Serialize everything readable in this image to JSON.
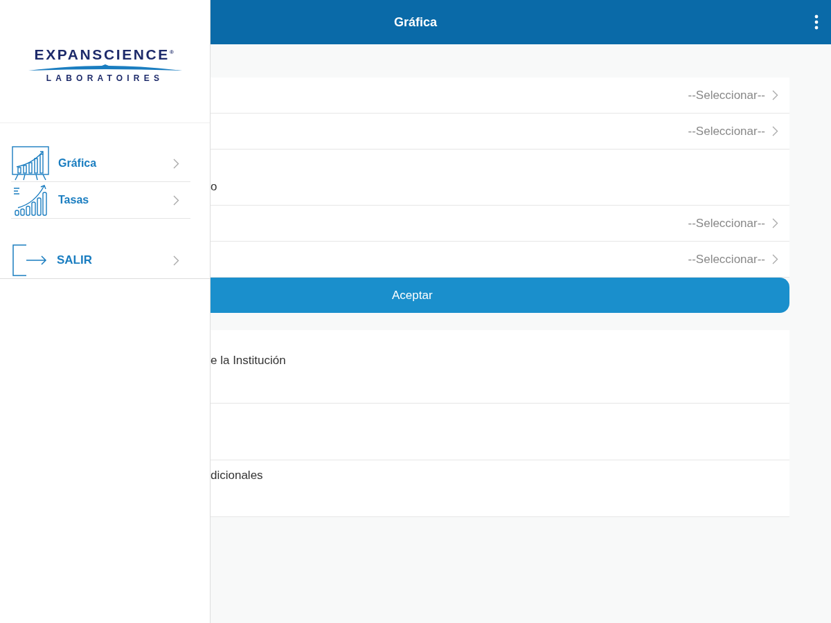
{
  "header": {
    "title": "Gráfica"
  },
  "drawer": {
    "logo": {
      "wordmark": "EXPANSCIENCE$^{®}$",
      "subtitle": "LABORATOIRES"
    },
    "items": [
      {
        "kind": "chart",
        "label": "Gráfica"
      },
      {
        "kind": "rates",
        "label": "Tasas"
      }
    ],
    "exit": {
      "label": "SALIR"
    }
  },
  "form": {
    "rows": [
      {
        "kind": "select",
        "value": "--Seleccionar--"
      },
      {
        "kind": "select",
        "value": "--Seleccionar--"
      },
      {
        "kind": "text",
        "label": "o"
      },
      {
        "kind": "select",
        "value": "--Seleccionar--"
      },
      {
        "kind": "select",
        "value": "--Seleccionar--"
      }
    ],
    "button": "Aceptar"
  },
  "sections": [
    {
      "kind": "labeled",
      "label": "e la Institución"
    },
    {
      "kind": "blank"
    },
    {
      "kind": "labeled",
      "label": "dicionales"
    }
  ]
}
